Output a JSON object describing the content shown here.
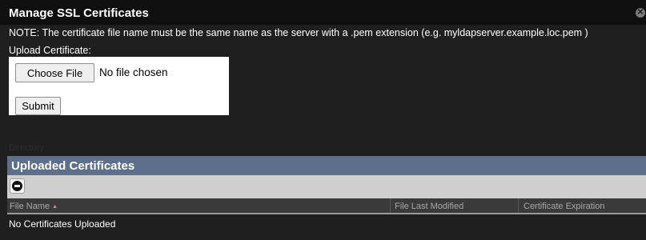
{
  "dialog": {
    "title": "Manage SSL Certificates",
    "close_icon": "close-icon",
    "note": "NOTE: The certificate file name must be the same name as the server with a .pem extension (e.g. myldapserver.example.loc.pem )"
  },
  "upload": {
    "label": "Upload Certificate:",
    "choose_file_label": "Choose File",
    "file_status": "No file chosen",
    "submit_label": "Submit"
  },
  "background_text": "Directory",
  "certificates": {
    "section_title": "Uploaded Certificates",
    "remove_icon": "remove-icon",
    "columns": [
      {
        "label": "File Name",
        "sort": "ascending"
      },
      {
        "label": "File Last Modified"
      },
      {
        "label": "Certificate Expiration"
      }
    ],
    "sort_indicator": "▲",
    "empty_message": "No Certificates Uploaded"
  }
}
